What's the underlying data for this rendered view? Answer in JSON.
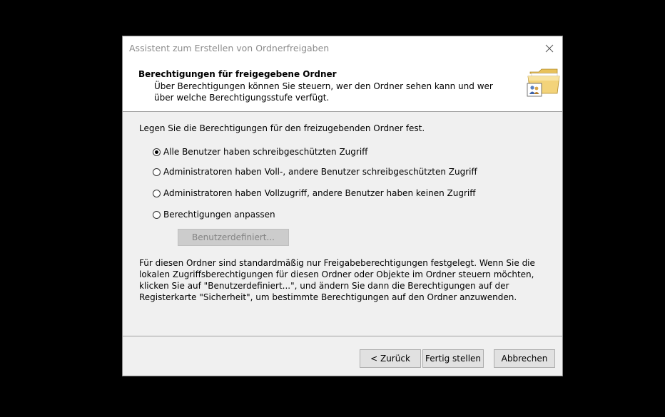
{
  "window": {
    "title": "Assistent zum Erstellen von Ordnerfreigaben"
  },
  "header": {
    "title": "Berechtigungen für freigegebene Ordner",
    "subtitle": "Über Berechtigungen können Sie steuern, wer den Ordner sehen kann und wer über welche Berechtigungsstufe verfügt.",
    "icon": "shared-folder-icon"
  },
  "content": {
    "intro": "Legen Sie die Berechtigungen für den freizugebenden Ordner fest.",
    "options": [
      {
        "label": "Alle Benutzer haben schreibgeschützten Zugriff",
        "selected": true
      },
      {
        "label": "Administratoren haben Voll-, andere Benutzer schreibgeschützten Zugriff",
        "selected": false
      },
      {
        "label": "Administratoren haben Vollzugriff, andere Benutzer haben keinen Zugriff",
        "selected": false
      },
      {
        "label": "Berechtigungen anpassen",
        "selected": false
      }
    ],
    "custom_button": "Benutzerdefiniert...",
    "info_lines": [
      "Für diesen Ordner sind standardmäßig nur Freigabeberechtigungen festgelegt. Wenn Sie die",
      "lokalen Zugriffsberechtigungen für diesen Ordner oder Objekte im Ordner steuern möchten,",
      "klicken Sie auf \"Benutzerdefiniert...\", und ändern Sie dann die Berechtigungen auf der",
      "Registerkarte \"Sicherheit\", um bestimmte Berechtigungen auf den Ordner anzuwenden."
    ]
  },
  "footer": {
    "back": "< Zurück",
    "finish": "Fertig stellen",
    "cancel": "Abbrechen"
  }
}
